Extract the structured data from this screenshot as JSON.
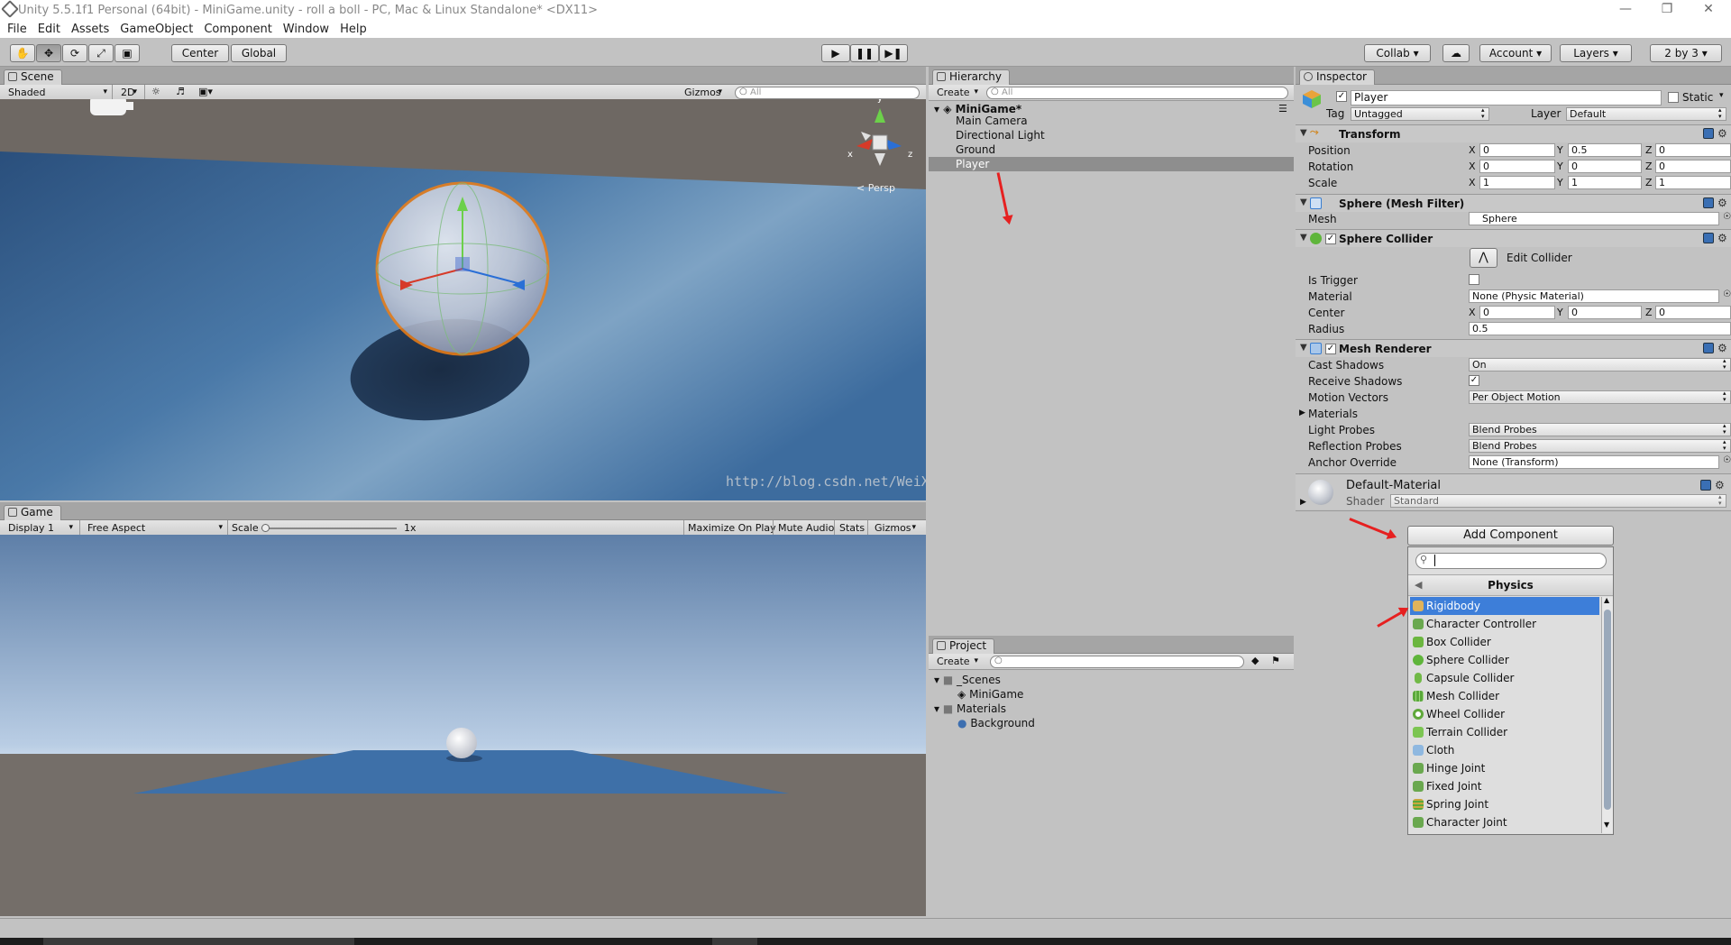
{
  "window": {
    "title": "Unity 5.5.1f1 Personal (64bit) - MiniGame.unity - roll a boll - PC, Mac & Linux Standalone* <DX11>"
  },
  "menu": [
    "File",
    "Edit",
    "Assets",
    "GameObject",
    "Component",
    "Window",
    "Help"
  ],
  "toolbar": {
    "pivot": "Center",
    "space": "Global",
    "collab": "Collab",
    "account": "Account",
    "layers": "Layers",
    "layout": "2 by 3"
  },
  "scene": {
    "tab": "Scene",
    "shading": "Shaded",
    "mode2d": "2D",
    "gizmos": "Gizmos",
    "search": "All",
    "persp": "Persp",
    "axes": {
      "y": "y",
      "x": "x",
      "z": "z"
    }
  },
  "watermark": "http://blog.csdn.net/WeiXinBaiHu",
  "game": {
    "tab": "Game",
    "display": "Display 1",
    "aspect": "Free Aspect",
    "scale_label": "Scale",
    "scale_value": "1x",
    "scale_fraction": 0,
    "maximize": "Maximize On Play",
    "mute": "Mute Audio",
    "stats": "Stats",
    "gizmos": "Gizmos"
  },
  "hierarchy": {
    "tab": "Hierarchy",
    "create": "Create",
    "search": "All",
    "scene_name": "MiniGame*",
    "items": [
      "Main Camera",
      "Directional Light",
      "Ground",
      "Player"
    ],
    "selected": "Player"
  },
  "project": {
    "tab": "Project",
    "create": "Create",
    "tree": [
      {
        "label": "_Scenes",
        "children": [
          "MiniGame"
        ]
      },
      {
        "label": "Materials",
        "children": [
          "Background"
        ]
      }
    ]
  },
  "inspector": {
    "tab": "Inspector",
    "object_name": "Player",
    "static_label": "Static",
    "tag_label": "Tag",
    "tag_value": "Untagged",
    "layer_label": "Layer",
    "layer_value": "Default",
    "transform": {
      "title": "Transform",
      "rows": [
        {
          "label": "Position",
          "x": "0",
          "y": "0.5",
          "z": "0"
        },
        {
          "label": "Rotation",
          "x": "0",
          "y": "0",
          "z": "0"
        },
        {
          "label": "Scale",
          "x": "1",
          "y": "1",
          "z": "1"
        }
      ]
    },
    "mesh_filter": {
      "title": "Sphere (Mesh Filter)",
      "mesh_label": "Mesh",
      "mesh_value": "Sphere"
    },
    "sphere_collider": {
      "title": "Sphere Collider",
      "edit": "Edit Collider",
      "is_trigger": "Is Trigger",
      "material_label": "Material",
      "material_value": "None (Physic Material)",
      "center_label": "Center",
      "center": {
        "x": "0",
        "y": "0",
        "z": "0"
      },
      "radius_label": "Radius",
      "radius_value": "0.5"
    },
    "mesh_renderer": {
      "title": "Mesh Renderer",
      "rows": [
        {
          "label": "Cast Shadows",
          "value": "On"
        },
        {
          "label": "Receive Shadows",
          "value": ""
        },
        {
          "label": "Motion Vectors",
          "value": "Per Object Motion"
        },
        {
          "label": "Materials",
          "value": ""
        },
        {
          "label": "Light Probes",
          "value": "Blend Probes"
        },
        {
          "label": "Reflection Probes",
          "value": "Blend Probes"
        },
        {
          "label": "Anchor Override",
          "value": "None (Transform)"
        }
      ]
    },
    "material": {
      "name": "Default-Material",
      "shader_label": "Shader",
      "shader_value": "Standard"
    },
    "add_component": "Add Component",
    "ac_category": "Physics",
    "ac_items": [
      "Rigidbody",
      "Character Controller",
      "Box Collider",
      "Sphere Collider",
      "Capsule Collider",
      "Mesh Collider",
      "Wheel Collider",
      "Terrain Collider",
      "Cloth",
      "Hinge Joint",
      "Fixed Joint",
      "Spring Joint",
      "Character Joint"
    ],
    "ac_selected": "Rigidbody"
  },
  "colors": {
    "selection": "#3d7ed9",
    "annotation_arrow": "#e62020",
    "panel_bg": "#c2c2c2"
  }
}
